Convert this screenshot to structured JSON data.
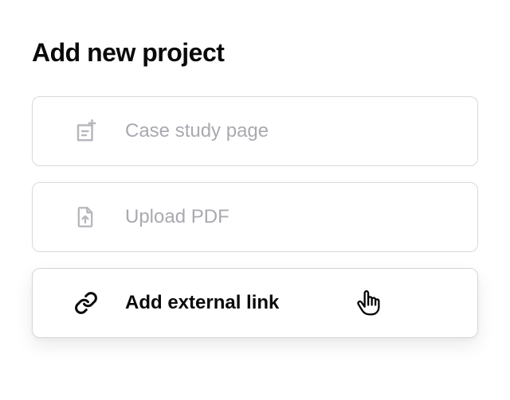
{
  "title": "Add new project",
  "options": [
    {
      "label": "Case study page",
      "icon": "page-plus-icon"
    },
    {
      "label": "Upload PDF",
      "icon": "file-upload-icon"
    },
    {
      "label": "Add external link",
      "icon": "link-icon"
    }
  ]
}
